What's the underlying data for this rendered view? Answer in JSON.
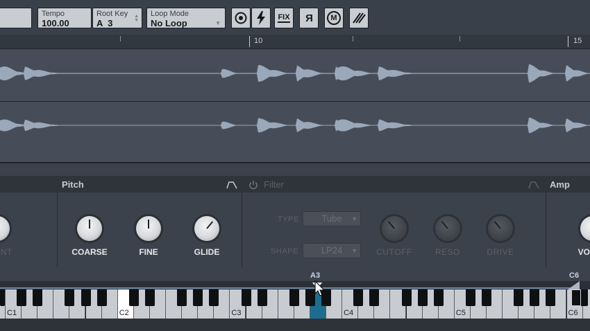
{
  "toolbar": {
    "tempo_label": "Tempo",
    "tempo_value": "100.00",
    "rootkey_label": "Root Key",
    "rootkey_value": "A  3",
    "loopmode_label": "Loop Mode",
    "loopmode_value": "No Loop",
    "fix_label": "FIX",
    "reverse_label": "R",
    "m_label": "M"
  },
  "ruler": {
    "marks": [
      "10",
      "15"
    ]
  },
  "sections": {
    "pitch_title": "Pitch",
    "filter_title": "Filter",
    "amp_title": "Amp"
  },
  "pitch": {
    "formant_label": "MANT",
    "coarse_label": "COARSE",
    "fine_label": "FINE",
    "glide_label": "GLIDE"
  },
  "filter": {
    "type_label": "TYPE",
    "type_value": "Tube",
    "shape_label": "SHAPE",
    "shape_value": "LP24",
    "cutoff_label": "CUTOFF",
    "reso_label": "RESO",
    "drive_label": "DRIVE"
  },
  "amp": {
    "volume_label": "VO"
  },
  "keyboard": {
    "root_marker": "A3",
    "range_marker": "C6",
    "octave_labels": [
      "C1",
      "C2",
      "C3",
      "C4",
      "C5",
      "C6"
    ]
  },
  "colors": {
    "accent": "#1b6e8f",
    "panel": "#3c424b",
    "wave": "#9aa8ba"
  }
}
